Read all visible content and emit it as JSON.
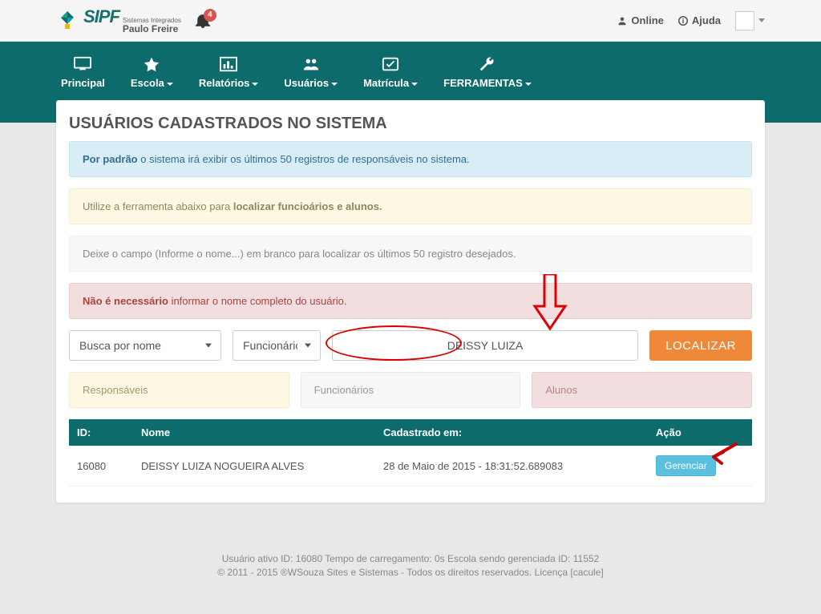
{
  "topbar": {
    "logo": {
      "sipf": "SIPF",
      "line1": "Sistemas Integrados",
      "line2": "Paulo Freire"
    },
    "notif_count": "4",
    "online": "Online",
    "help": "Ajuda"
  },
  "nav": {
    "principal": "Principal",
    "escola": "Escola",
    "relatorios": "Relatórios",
    "usuarios": "Usuários",
    "matricula": "Matrícula",
    "ferramentas": "FERRAMENTAS"
  },
  "page": {
    "title": "USUÁRIOS CADASTRADOS NO SISTEMA",
    "alert1_b": "Por padrão",
    "alert1_t": " o sistema irá exibir os últimos 50 registros de responsáveis no sistema.",
    "alert2_pre": "Utilize a ferramenta abaixo para ",
    "alert2_b": "localizar funcioários e alunos.",
    "alert3": "Deixe o campo (Informe o nome...) em branco para localizar os últimos 50 registro desejados.",
    "alert4_b": "Não é necessário",
    "alert4_t": " informar o nome completo do usuário."
  },
  "search": {
    "mode": "Busca por nome",
    "type": "Funcionários",
    "query": "DEISSY LUIZA",
    "button": "LOCALIZAR"
  },
  "categories": {
    "responsaveis": "Responsáveis",
    "funcionarios": "Funcionários",
    "alunos": "Alunos"
  },
  "table": {
    "headers": {
      "id": "ID:",
      "nome": "Nome",
      "cad": "Cadastrado em:",
      "acao": "Ação"
    },
    "rows": [
      {
        "id": "16080",
        "nome": "DEISSY LUIZA NOGUEIRA ALVES",
        "cad": "28 de Maio de 2015 - 18:31:52.689083",
        "acao": "Gerenciar"
      }
    ]
  },
  "footer": {
    "line1": "Usuário ativo ID: 16080 Tempo de carregamento: 0s Escola sendo gerenciada ID: 11552",
    "line2": "© 2011 - 2015 ®WSouza Sites e Sistemas - Todos os direitos reservados. Licença [cacule]"
  }
}
